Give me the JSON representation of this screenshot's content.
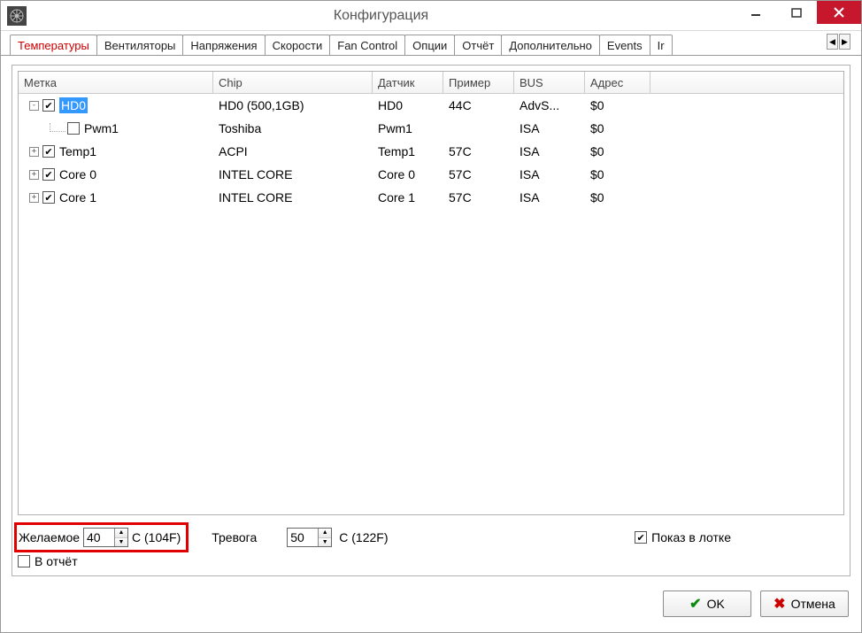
{
  "window": {
    "title": "Конфигурация"
  },
  "tabs": [
    {
      "label": "Температуры",
      "active": true
    },
    {
      "label": "Вентиляторы",
      "active": false
    },
    {
      "label": "Напряжения",
      "active": false
    },
    {
      "label": "Скорости",
      "active": false
    },
    {
      "label": "Fan Control",
      "active": false
    },
    {
      "label": "Опции",
      "active": false
    },
    {
      "label": "Отчёт",
      "active": false
    },
    {
      "label": "Дополнительно",
      "active": false
    },
    {
      "label": "Events",
      "active": false
    },
    {
      "label": "Ir",
      "active": false
    }
  ],
  "columns": {
    "label": "Метка",
    "chip": "Chip",
    "sensor": "Датчик",
    "sample": "Пример",
    "bus": "BUS",
    "addr": "Адрес"
  },
  "rows": [
    {
      "indent": 0,
      "expander": "-",
      "checked": true,
      "selected": true,
      "label": "HD0",
      "chip": "HD0 (500,1GB)",
      "sensor": "HD0",
      "sample": "44C",
      "bus": "AdvS...",
      "addr": "$0"
    },
    {
      "indent": 1,
      "expander": "",
      "checked": false,
      "selected": false,
      "label": "Pwm1",
      "chip": "Toshiba",
      "sensor": "Pwm1",
      "sample": "",
      "bus": "ISA",
      "addr": "$0"
    },
    {
      "indent": 0,
      "expander": "+",
      "checked": true,
      "selected": false,
      "label": "Temp1",
      "chip": "ACPI",
      "sensor": "Temp1",
      "sample": "57C",
      "bus": "ISA",
      "addr": "$0"
    },
    {
      "indent": 0,
      "expander": "+",
      "checked": true,
      "selected": false,
      "label": "Core 0",
      "chip": "INTEL CORE",
      "sensor": "Core 0",
      "sample": "57C",
      "bus": "ISA",
      "addr": "$0"
    },
    {
      "indent": 0,
      "expander": "+",
      "checked": true,
      "selected": false,
      "label": "Core 1",
      "chip": "INTEL CORE",
      "sensor": "Core 1",
      "sample": "57C",
      "bus": "ISA",
      "addr": "$0"
    }
  ],
  "controls": {
    "desired_label": "Желаемое",
    "desired_value": "40",
    "desired_suffix": "C (104F)",
    "alarm_label": "Тревога",
    "alarm_value": "50",
    "alarm_suffix": "C (122F)",
    "tray_label": "Показ в лотке",
    "tray_checked": true,
    "in_report_label": "В отчёт",
    "in_report_checked": false
  },
  "buttons": {
    "ok": "OK",
    "cancel": "Отмена"
  }
}
